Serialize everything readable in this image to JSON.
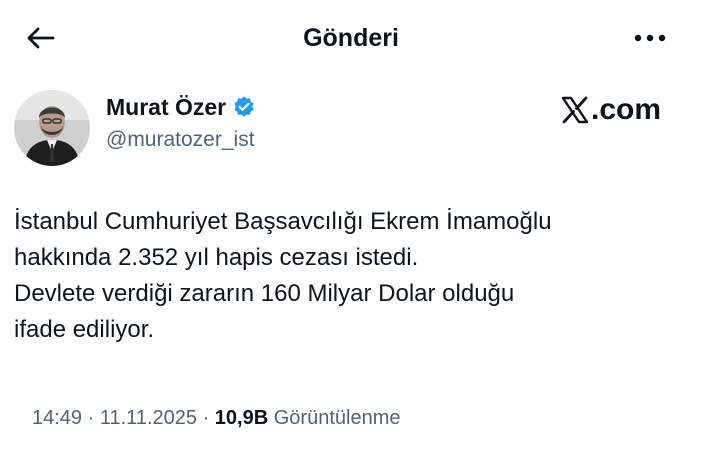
{
  "header": {
    "title": "Gönderi",
    "back_icon": "arrow-left-icon",
    "more_icon": "more-horizontal-icon"
  },
  "author": {
    "display_name": "Murat Özer",
    "handle": "@muratozer_ist",
    "verified_icon": "verified-badge-icon",
    "verified_color": "#1d9bf0"
  },
  "brand": {
    "logo_icon": "x-logo-icon",
    "text": ".com"
  },
  "tweet": {
    "lines": [
      "İstanbul Cumhuriyet Başsavcılığı Ekrem İmamoğlu",
      "hakkında 2.352 yıl hapis cezası istedi.",
      "Devlete verdiği zararın 160 Milyar Dolar olduğu",
      "ifade ediliyor."
    ]
  },
  "meta": {
    "time": "14:49",
    "separator": "·",
    "date": "11.11.2025",
    "views_count": "10,9B",
    "views_label": "Görüntülenme"
  },
  "colors": {
    "text": "#0f1419",
    "secondary": "#536471",
    "accent": "#1d9bf0"
  }
}
